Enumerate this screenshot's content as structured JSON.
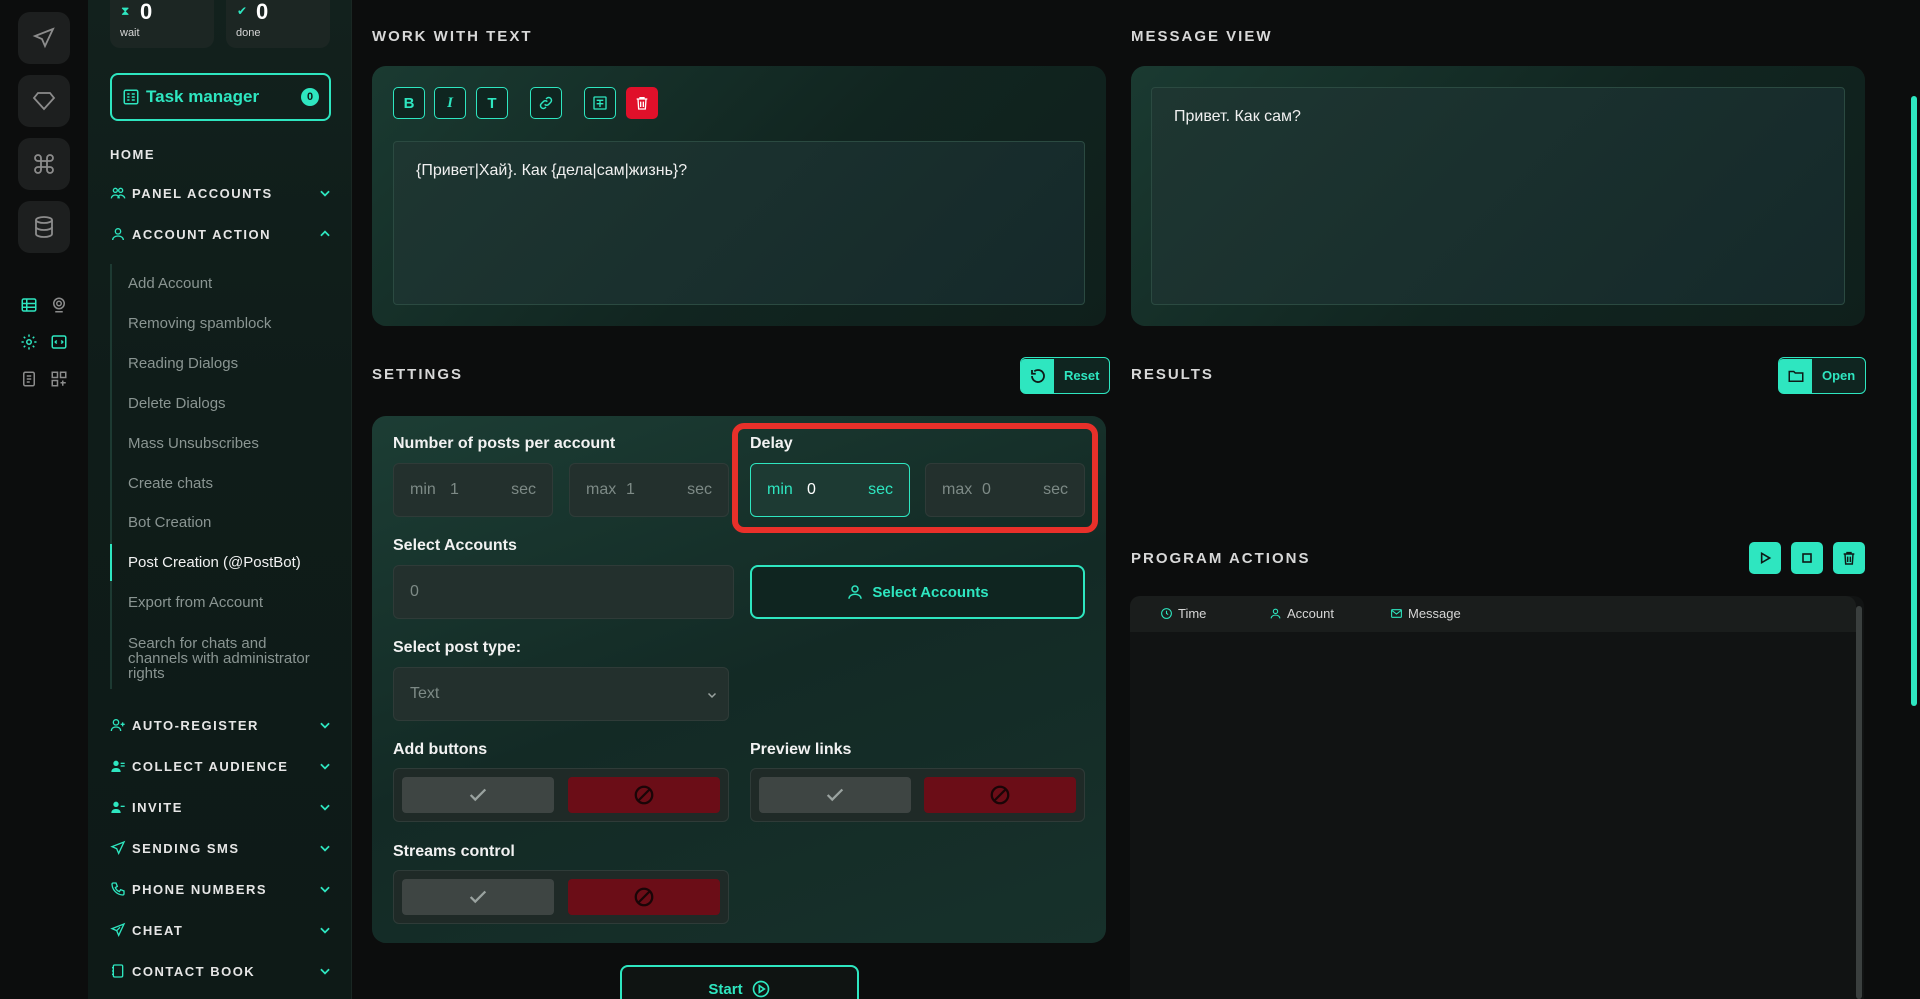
{
  "counters": {
    "wait": {
      "value": "0",
      "label": "wait"
    },
    "done": {
      "value": "0",
      "label": "done"
    }
  },
  "sidebar": {
    "task_manager": {
      "label": "Task manager",
      "badge": "0"
    },
    "home": "HOME",
    "sections": [
      {
        "label": "PANEL ACCOUNTS",
        "icon": "users-icon",
        "expanded": false
      },
      {
        "label": "ACCOUNT ACTION",
        "icon": "user-icon",
        "expanded": true
      },
      {
        "label": "AUTO-REGISTER",
        "icon": "user-plus-icon",
        "expanded": false
      },
      {
        "label": "COLLECT AUDIENCE",
        "icon": "user-list-icon",
        "expanded": false
      },
      {
        "label": "INVITE",
        "icon": "user-invite-icon",
        "expanded": false
      },
      {
        "label": "SENDING SMS",
        "icon": "send-icon",
        "expanded": false
      },
      {
        "label": "PHONE NUMBERS",
        "icon": "phone-icon",
        "expanded": false
      },
      {
        "label": "CHEAT",
        "icon": "send-plus-icon",
        "expanded": false
      },
      {
        "label": "CONTACT BOOK",
        "icon": "book-icon",
        "expanded": false
      }
    ],
    "sub_items": [
      "Add Account",
      "Removing spamblock",
      "Reading Dialogs",
      "Delete Dialogs",
      "Mass Unsubscribes",
      "Create chats",
      "Bot Creation",
      "Post Creation (@PostBot)",
      "Export from Account",
      "Search for chats and channels with administrator rights"
    ],
    "active_sub_item": "Post Creation (@PostBot)"
  },
  "work_with_text": {
    "title": "WORK WITH TEXT",
    "toolbar": [
      "B",
      "I",
      "T"
    ],
    "text": "{Привет|Хай}. Как {дела|сам|жизнь}?"
  },
  "message_view": {
    "title": "MESSAGE VIEW",
    "text": "Привет. Как сам?"
  },
  "settings": {
    "title": "SETTINGS",
    "reset_label": "Reset",
    "posts_label": "Number of posts per account",
    "posts_min": {
      "prefix": "min",
      "value": "1",
      "unit": "sec"
    },
    "posts_max": {
      "prefix": "max",
      "value": "1",
      "unit": "sec"
    },
    "delay_label": "Delay",
    "delay_min": {
      "prefix": "min",
      "value": "0",
      "unit": "sec"
    },
    "delay_max": {
      "prefix": "max",
      "value": "0",
      "unit": "sec"
    },
    "select_accounts_label": "Select Accounts",
    "select_accounts_value": "0",
    "select_accounts_button": "Select Accounts",
    "post_type_label": "Select post type:",
    "post_type_value": "Text",
    "add_buttons_label": "Add buttons",
    "preview_links_label": "Preview links",
    "streams_control_label": "Streams control",
    "start_label": "Start"
  },
  "results": {
    "title": "RESULTS",
    "open_label": "Open"
  },
  "program_actions": {
    "title": "PROGRAM ACTIONS",
    "columns": [
      "Time",
      "Account",
      "Message"
    ]
  },
  "colors": {
    "accent": "#2ee6c0",
    "danger": "#e0102a",
    "highlight": "#e8302a"
  }
}
